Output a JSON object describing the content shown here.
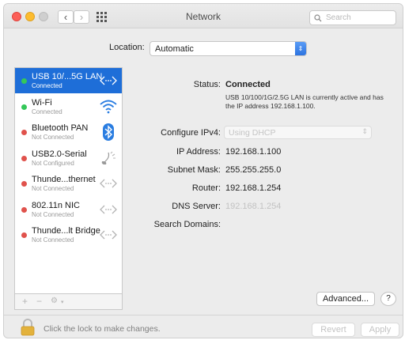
{
  "window": {
    "title": "Network",
    "search_placeholder": "Search"
  },
  "location": {
    "label": "Location:",
    "value": "Automatic"
  },
  "services": [
    {
      "name": "USB 10/...5G LAN",
      "status": "Connected",
      "dot": "#35c759",
      "icon": "ethernet-icon",
      "selected": true
    },
    {
      "name": "Wi-Fi",
      "status": "Connected",
      "dot": "#35c759",
      "icon": "wifi-icon",
      "selected": false
    },
    {
      "name": "Bluetooth PAN",
      "status": "Not Connected",
      "dot": "#e0524c",
      "icon": "bluetooth-icon",
      "selected": false
    },
    {
      "name": "USB2.0-Serial",
      "status": "Not Configured",
      "dot": "#e0524c",
      "icon": "phone-modem-icon",
      "selected": false
    },
    {
      "name": "Thunde...thernet",
      "status": "Not Connected",
      "dot": "#e0524c",
      "icon": "ethernet-icon",
      "selected": false
    },
    {
      "name": "802.11n NIC",
      "status": "Not Connected",
      "dot": "#e0524c",
      "icon": "ethernet-icon",
      "selected": false
    },
    {
      "name": "Thunde...lt Bridge",
      "status": "Not Connected",
      "dot": "#e0524c",
      "icon": "ethernet-icon",
      "selected": false
    }
  ],
  "sidebar_tools": {
    "add": "+",
    "remove": "−",
    "action": "⚙"
  },
  "detail": {
    "status_label": "Status:",
    "status_value": "Connected",
    "status_note": "USB 10/100/1G/2.5G LAN is currently active and has the IP address 192.168.1.100.",
    "configure_label": "Configure IPv4:",
    "configure_value": "Using DHCP",
    "ip_label": "IP Address:",
    "ip_value": "192.168.1.100",
    "mask_label": "Subnet Mask:",
    "mask_value": "255.255.255.0",
    "router_label": "Router:",
    "router_value": "192.168.1.254",
    "dns_label": "DNS Server:",
    "dns_value": "192.168.1.254",
    "search_domains_label": "Search Domains:"
  },
  "buttons": {
    "advanced": "Advanced...",
    "help": "?",
    "revert": "Revert",
    "apply": "Apply"
  },
  "footer": {
    "lock_text": "Click the lock to make changes."
  },
  "colors": {
    "accent": "#1e6ed8",
    "connected": "#35c759",
    "not_connected": "#e0524c"
  }
}
